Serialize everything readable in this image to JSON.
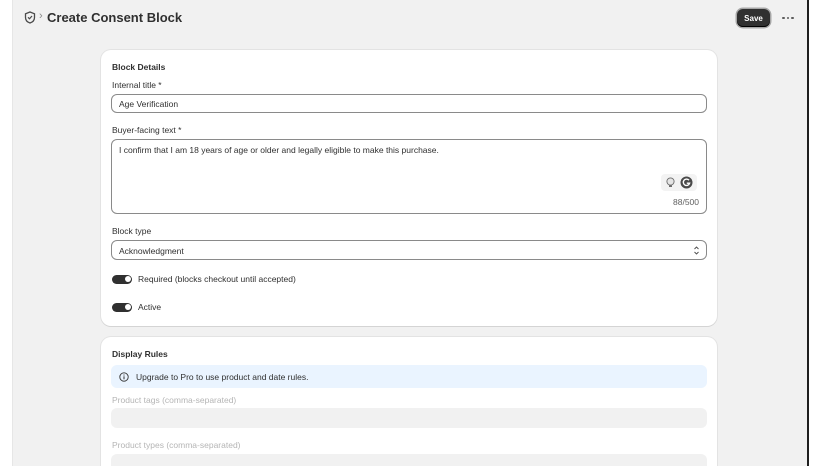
{
  "header": {
    "title": "Create Consent Block",
    "breadcrumb_separator": "›",
    "save_label": "Save",
    "icons": {
      "brand": "shield-icon",
      "more": "more-horizontal-icon"
    }
  },
  "block_details": {
    "title": "Block Details",
    "internal_title": {
      "label": "Internal title *",
      "value": "Age Verification"
    },
    "buyer_text": {
      "label": "Buyer-facing text *",
      "value": "I confirm that I am 18 years of age or older and legally eligible to make this purchase.",
      "char_count": "88/500",
      "icons": [
        "lightbulb-icon",
        "grammarly-icon"
      ]
    },
    "block_type": {
      "label": "Block type",
      "value": "Acknowledgment"
    },
    "required_toggle": {
      "label": "Required (blocks checkout until accepted)",
      "on": true
    },
    "active_toggle": {
      "label": "Active",
      "on": true
    }
  },
  "display_rules": {
    "title": "Display Rules",
    "banner": {
      "text": "Upgrade to Pro to use product and date rules.",
      "icon": "info-icon"
    },
    "product_tags": {
      "label": "Product tags (comma-separated)"
    },
    "product_types": {
      "label": "Product types (comma-separated)"
    }
  },
  "colors": {
    "primary_button": "#303030",
    "banner_bg": "#eaf4ff",
    "page_bg": "#f1f1f1"
  }
}
